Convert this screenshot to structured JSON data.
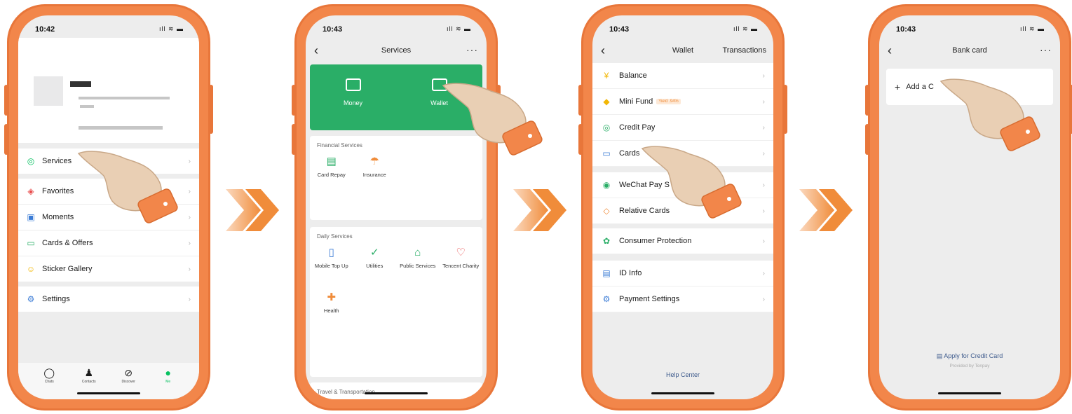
{
  "phone1": {
    "status_time": "10:42",
    "menu": [
      {
        "label": "Services",
        "icon": "services-icon",
        "glyph": "◎",
        "color": "#07c160"
      },
      {
        "label": "Favorites",
        "icon": "favorites-icon",
        "glyph": "◈",
        "color": "#e84b4b"
      },
      {
        "label": "Moments",
        "icon": "moments-icon",
        "glyph": "▣",
        "color": "#3a7bd5"
      },
      {
        "label": "Cards & Offers",
        "icon": "cards-offers-icon",
        "glyph": "▭",
        "color": "#2aae67"
      },
      {
        "label": "Sticker Gallery",
        "icon": "sticker-icon",
        "glyph": "☺",
        "color": "#f2b705"
      },
      {
        "label": "Settings",
        "icon": "settings-icon",
        "glyph": "⚙",
        "color": "#3a7bd5"
      }
    ],
    "tabs": [
      {
        "label": "Chats",
        "icon": "chats-icon",
        "glyph": "◯"
      },
      {
        "label": "Contacts",
        "icon": "contacts-icon",
        "glyph": "♟"
      },
      {
        "label": "Discover",
        "icon": "discover-icon",
        "glyph": "⊘"
      },
      {
        "label": "Me",
        "icon": "me-icon",
        "glyph": "●"
      }
    ]
  },
  "phone2": {
    "status_time": "10:43",
    "title": "Services",
    "green": [
      {
        "label": "Money",
        "icon": "money-icon"
      },
      {
        "label": "Wallet",
        "icon": "wallet-icon"
      }
    ],
    "financial_title": "Financial Services",
    "financial": [
      {
        "label": "Card Repay",
        "icon": "card-repay-icon",
        "glyph": "▤",
        "color": "#2aae67"
      },
      {
        "label": "Insurance",
        "icon": "insurance-icon",
        "glyph": "☂",
        "color": "#f08c3a"
      }
    ],
    "daily_title": "Daily Services",
    "daily": [
      {
        "label": "Mobile Top Up",
        "icon": "mobile-topup-icon",
        "glyph": "▯",
        "color": "#3a7bd5"
      },
      {
        "label": "Utilities",
        "icon": "utilities-icon",
        "glyph": "✓",
        "color": "#2aae67"
      },
      {
        "label": "Public Services",
        "icon": "public-services-icon",
        "glyph": "⌂",
        "color": "#2aae67"
      },
      {
        "label": "Tencent Charity",
        "icon": "charity-icon",
        "glyph": "♡",
        "color": "#e84b4b"
      },
      {
        "label": "Health",
        "icon": "health-icon",
        "glyph": "✚",
        "color": "#f08c3a"
      }
    ],
    "travel_title": "Travel & Transportation"
  },
  "phone3": {
    "status_time": "10:43",
    "title": "Wallet",
    "right_link": "Transactions",
    "items": [
      {
        "label": "Balance",
        "icon": "balance-icon",
        "glyph": "¥",
        "color": "#f2b705",
        "badge": ""
      },
      {
        "label": "Mini Fund",
        "icon": "mini-fund-icon",
        "glyph": "◆",
        "color": "#f2b705",
        "badge": "Yield .94%"
      },
      {
        "label": "Credit Pay",
        "icon": "credit-pay-icon",
        "glyph": "◎",
        "color": "#2aae67",
        "badge": ""
      },
      {
        "label": "Cards",
        "icon": "cards-icon",
        "glyph": "▭",
        "color": "#3a7bd5",
        "badge": ""
      },
      {
        "label": "WeChat Pay S",
        "icon": "wechat-pay-icon",
        "glyph": "◉",
        "color": "#2aae67",
        "badge": ""
      },
      {
        "label": "Relative Cards",
        "icon": "relative-cards-icon",
        "glyph": "◇",
        "color": "#f08c3a",
        "badge": ""
      },
      {
        "label": "Consumer Protection",
        "icon": "consumer-protection-icon",
        "glyph": "✿",
        "color": "#2aae67",
        "badge": ""
      },
      {
        "label": "ID Info",
        "icon": "id-info-icon",
        "glyph": "▤",
        "color": "#3a7bd5",
        "badge": ""
      },
      {
        "label": "Payment Settings",
        "icon": "payment-settings-icon",
        "glyph": "⚙",
        "color": "#3a7bd5",
        "badge": ""
      }
    ],
    "help": "Help Center"
  },
  "phone4": {
    "status_time": "10:43",
    "title": "Bank card",
    "add_card": "Add a C",
    "apply": "Apply for Credit Card",
    "provided": "Provided by Tenpay"
  },
  "colors": {
    "phone_frame": "#f2864a",
    "green": "#2aae67",
    "arrow": "#f08c3a"
  }
}
